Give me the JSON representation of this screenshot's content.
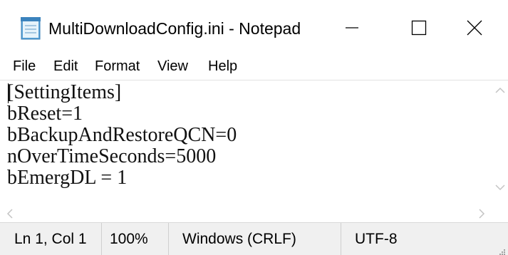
{
  "window": {
    "title": "MultiDownloadConfig.ini - Notepad",
    "app_icon": "notepad-icon",
    "controls": {
      "minimize_icon": "minimize-icon",
      "maximize_icon": "maximize-icon",
      "close_icon": "close-icon"
    }
  },
  "menu": {
    "items": [
      "File",
      "Edit",
      "Format",
      "View",
      "Help"
    ]
  },
  "editor": {
    "lines": [
      "[SettingItems]",
      "bReset=1",
      "bBackupAndRestoreQCN=0",
      "nOverTimeSeconds=5000",
      "bEmergDL = 1"
    ]
  },
  "scrollbars": {
    "up_icon": "chevron-up-icon",
    "down_icon": "chevron-down-icon",
    "left_icon": "chevron-left-icon",
    "right_icon": "chevron-right-icon"
  },
  "status": {
    "position": "Ln 1, Col 1",
    "zoom": "100%",
    "line_ending": "Windows (CRLF)",
    "encoding": "UTF-8"
  },
  "colors": {
    "background": "#ffffff",
    "statusbar": "#f0f0f0",
    "scroll_arrow": "#c4c4c4"
  }
}
